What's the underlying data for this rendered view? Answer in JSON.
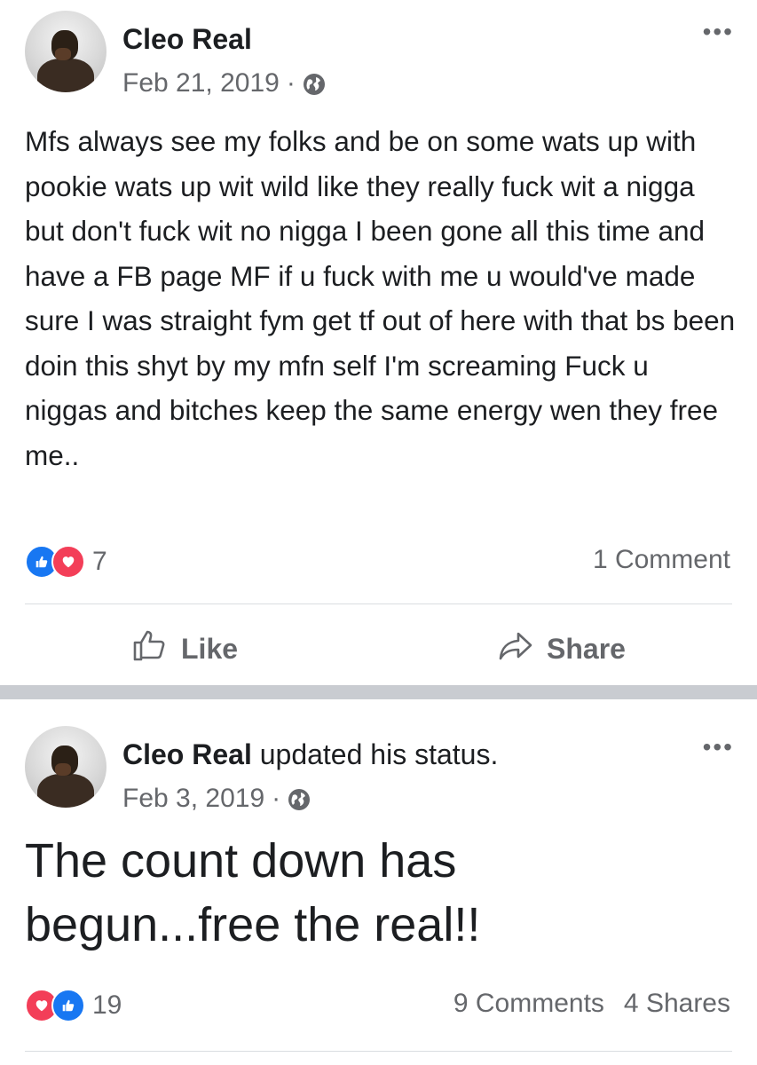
{
  "posts": [
    {
      "author": "Cleo Real",
      "author_suffix": "",
      "date": "Feb 21, 2019",
      "date_separator": "·",
      "privacy_icon": "globe-icon",
      "more_icon": "more-icon",
      "more_glyph": "•••",
      "text": "Mfs always see my folks and be on some wats up with pookie wats up wit wild like they really fuck wit a nigga but don't fuck wit no nigga I been gone all this time and have a FB page MF if u fuck with me u would've made sure I was straight fym get tf out of here with that bs been doin this shyt by my mfn self I'm screaming Fuck u niggas and bitches keep the same energy wen they free me..",
      "reactions": [
        "like",
        "love"
      ],
      "reaction_count": "7",
      "comments": "1 Comment",
      "shares": "",
      "actions": {
        "like": "Like",
        "share": "Share"
      }
    },
    {
      "author": "Cleo Real",
      "author_suffix": "updated his status.",
      "date": "Feb 3, 2019",
      "date_separator": "·",
      "privacy_icon": "globe-icon",
      "more_icon": "more-icon",
      "more_glyph": "•••",
      "text": "The count down has begun...free the real!!",
      "reactions": [
        "love",
        "like"
      ],
      "reaction_count": "19",
      "comments": "9 Comments",
      "shares": "4 Shares"
    }
  ],
  "colors": {
    "like_blue": "#1877f2",
    "love_red": "#f33e58",
    "meta_gray": "#65676b",
    "separator": "#c9ccd1"
  }
}
